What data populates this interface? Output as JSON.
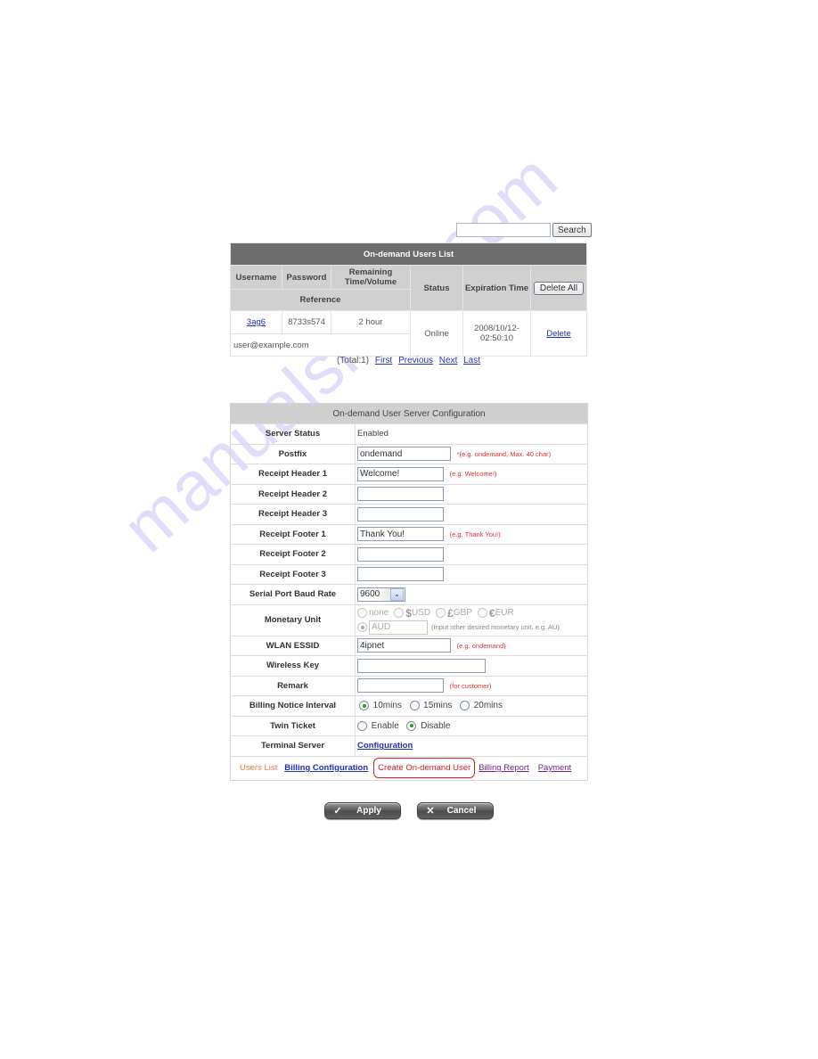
{
  "search": {
    "input_value": "",
    "button_label": "Search"
  },
  "users_list": {
    "title": "On-demand Users List",
    "columns": {
      "username": "Username",
      "password": "Password",
      "remaining": "Remaining Time/Volume",
      "reference": "Reference",
      "status": "Status",
      "expiration": "Expiration Time"
    },
    "delete_all_label": "Delete All",
    "rows": [
      {
        "username": "3ag6",
        "password": "8733s574",
        "remaining": "2 hour",
        "reference": "user@example.com",
        "status": "Online",
        "expiration": "2008/10/12-02:50:10",
        "delete_label": "Delete"
      }
    ],
    "pager": {
      "total": "(Total:1)",
      "first": "First",
      "previous": "Previous",
      "next": "Next",
      "last": "Last"
    }
  },
  "config": {
    "title": "On-demand User Server Configuration",
    "server_status": {
      "label": "Server Status",
      "value": "Enabled"
    },
    "postfix": {
      "label": "Postfix",
      "value": "ondemand",
      "hint": "*(e.g. ondemand, Max. 40 char)"
    },
    "receipt_header_1": {
      "label": "Receipt Header 1",
      "value": "Welcome!",
      "hint": "(e.g. Welcome!)"
    },
    "receipt_header_2": {
      "label": "Receipt Header 2",
      "value": ""
    },
    "receipt_header_3": {
      "label": "Receipt Header 3",
      "value": ""
    },
    "receipt_footer_1": {
      "label": "Receipt Footer 1",
      "value": "Thank You!",
      "hint": "(e.g. Thank You!)"
    },
    "receipt_footer_2": {
      "label": "Receipt Footer 2",
      "value": ""
    },
    "receipt_footer_3": {
      "label": "Receipt Footer 3",
      "value": ""
    },
    "baud_rate": {
      "label": "Serial Port Baud Rate",
      "selected": "9600"
    },
    "monetary_unit": {
      "label": "Monetary Unit",
      "options": [
        {
          "symbol": "",
          "label": "none",
          "checked": false
        },
        {
          "symbol": "$",
          "label": "USD",
          "checked": false
        },
        {
          "symbol": "£",
          "label": "GBP",
          "checked": false
        },
        {
          "symbol": "€",
          "label": "EUR",
          "checked": false
        }
      ],
      "other_checked": true,
      "other_value": "AUD",
      "other_hint": "(Input other desired monetary unit, e.g. AU)"
    },
    "wlan_essid": {
      "label": "WLAN ESSID",
      "value": "4ipnet",
      "hint": "(e.g. ondemand)"
    },
    "wireless_key": {
      "label": "Wireless Key",
      "value": ""
    },
    "remark": {
      "label": "Remark",
      "value": "",
      "hint": "(for customer)"
    },
    "billing_notice": {
      "label": "Billing Notice Interval",
      "options": [
        {
          "label": "10mins",
          "checked": true
        },
        {
          "label": "15mins",
          "checked": false
        },
        {
          "label": "20mins",
          "checked": false
        }
      ]
    },
    "twin_ticket": {
      "label": "Twin Ticket",
      "options": [
        {
          "label": "Enable",
          "checked": false
        },
        {
          "label": "Disable",
          "checked": true
        }
      ]
    },
    "terminal_server": {
      "label": "Terminal Server",
      "link": "Configuration"
    }
  },
  "nav": {
    "users_list": "Users List",
    "billing_configuration": "Billing Configuration",
    "create_user": "Create On-demand User",
    "billing_report": "Billing Report",
    "payment": "Payment"
  },
  "actions": {
    "apply": "Apply",
    "cancel": "Cancel"
  },
  "watermark": "manualshive.com",
  "colors": {
    "list_header_bg": "#6d6d6d",
    "column_header_bg": "#d0d0d0",
    "hint_red": "#e03030",
    "link_blue": "#1f2fbf",
    "current_tab_red": "#d81e1e",
    "users_list_orange": "#e87a4c",
    "payment_purple": "#7a1f8f",
    "radio_checked_green": "#2c9a2c"
  }
}
